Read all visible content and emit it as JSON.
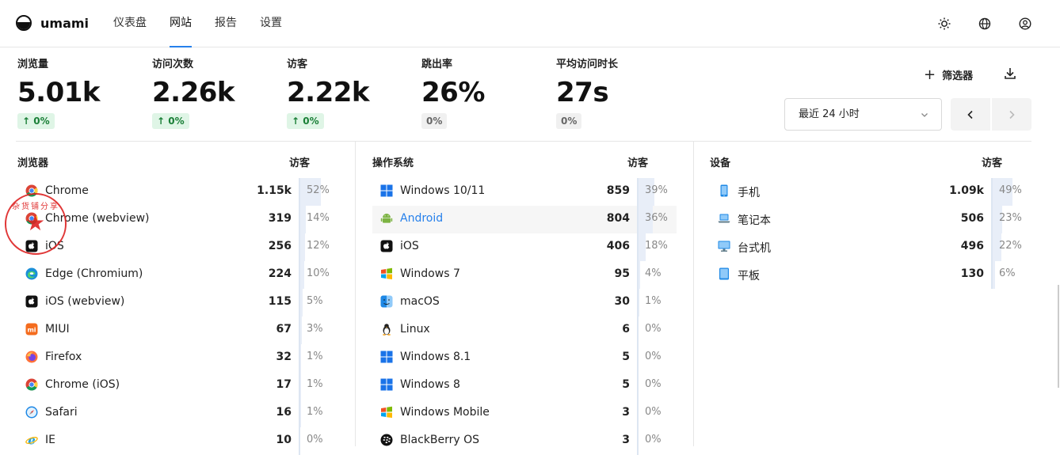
{
  "nav": {
    "brand": "umami",
    "items": [
      {
        "label": "仪表盘",
        "active": false
      },
      {
        "label": "网站",
        "active": true
      },
      {
        "label": "报告",
        "active": false
      },
      {
        "label": "设置",
        "active": false
      }
    ],
    "icons": [
      "sun-icon",
      "globe-icon",
      "user-icon"
    ]
  },
  "metrics": [
    {
      "label": "浏览量",
      "value": "5.01k",
      "change": "0%",
      "trend": "up"
    },
    {
      "label": "访问次数",
      "value": "2.26k",
      "change": "0%",
      "trend": "up"
    },
    {
      "label": "访客",
      "value": "2.22k",
      "change": "0%",
      "trend": "up"
    },
    {
      "label": "跳出率",
      "value": "26%",
      "change": "0%",
      "trend": "neutral"
    },
    {
      "label": "平均访问时长",
      "value": "27s",
      "change": "0%",
      "trend": "neutral"
    }
  ],
  "toolbar": {
    "filter_label": "筛选器",
    "date_range": "最近 24 小时"
  },
  "panels": [
    {
      "title": "浏览器",
      "metric_label": "访客",
      "rows": [
        {
          "label": "Chrome",
          "value": "1.15k",
          "pct": "52%",
          "share": 52,
          "icon": "chrome-icon"
        },
        {
          "label": "Chrome (webview)",
          "value": "319",
          "pct": "14%",
          "share": 14,
          "icon": "chrome-icon"
        },
        {
          "label": "iOS",
          "value": "256",
          "pct": "12%",
          "share": 12,
          "icon": "apple-icon"
        },
        {
          "label": "Edge (Chromium)",
          "value": "224",
          "pct": "10%",
          "share": 10,
          "icon": "edge-icon"
        },
        {
          "label": "iOS (webview)",
          "value": "115",
          "pct": "5%",
          "share": 5,
          "icon": "apple-icon"
        },
        {
          "label": "MIUI",
          "value": "67",
          "pct": "3%",
          "share": 3,
          "icon": "miui-icon"
        },
        {
          "label": "Firefox",
          "value": "32",
          "pct": "1%",
          "share": 1,
          "icon": "firefox-icon"
        },
        {
          "label": "Chrome (iOS)",
          "value": "17",
          "pct": "1%",
          "share": 1,
          "icon": "chrome-icon"
        },
        {
          "label": "Safari",
          "value": "16",
          "pct": "1%",
          "share": 1,
          "icon": "safari-icon"
        },
        {
          "label": "IE",
          "value": "10",
          "pct": "0%",
          "share": 0,
          "icon": "ie-icon"
        }
      ]
    },
    {
      "title": "操作系统",
      "metric_label": "访客",
      "rows": [
        {
          "label": "Windows 10/11",
          "value": "859",
          "pct": "39%",
          "share": 39,
          "icon": "windows-icon"
        },
        {
          "label": "Android",
          "value": "804",
          "pct": "36%",
          "share": 36,
          "icon": "android-icon",
          "highlight": true
        },
        {
          "label": "iOS",
          "value": "406",
          "pct": "18%",
          "share": 18,
          "icon": "apple-icon"
        },
        {
          "label": "Windows 7",
          "value": "95",
          "pct": "4%",
          "share": 4,
          "icon": "windows-legacy-icon"
        },
        {
          "label": "macOS",
          "value": "30",
          "pct": "1%",
          "share": 1,
          "icon": "macos-icon"
        },
        {
          "label": "Linux",
          "value": "6",
          "pct": "0%",
          "share": 0,
          "icon": "linux-icon"
        },
        {
          "label": "Windows 8.1",
          "value": "5",
          "pct": "0%",
          "share": 0,
          "icon": "windows-icon"
        },
        {
          "label": "Windows 8",
          "value": "5",
          "pct": "0%",
          "share": 0,
          "icon": "windows-icon"
        },
        {
          "label": "Windows Mobile",
          "value": "3",
          "pct": "0%",
          "share": 0,
          "icon": "windows-legacy-icon"
        },
        {
          "label": "BlackBerry OS",
          "value": "3",
          "pct": "0%",
          "share": 0,
          "icon": "blackberry-icon"
        }
      ]
    },
    {
      "title": "设备",
      "metric_label": "访客",
      "rows": [
        {
          "label": "手机",
          "value": "1.09k",
          "pct": "49%",
          "share": 49,
          "icon": "mobile-icon"
        },
        {
          "label": "笔记本",
          "value": "506",
          "pct": "23%",
          "share": 23,
          "icon": "laptop-icon"
        },
        {
          "label": "台式机",
          "value": "496",
          "pct": "22%",
          "share": 22,
          "icon": "desktop-icon"
        },
        {
          "label": "平板",
          "value": "130",
          "pct": "6%",
          "share": 6,
          "icon": "tablet-icon"
        }
      ]
    }
  ],
  "stamp": {
    "text": "杂货铺分享"
  },
  "colors": {
    "accent": "#2680eb",
    "positive": "#1a7f37",
    "bar": "#e8eef8"
  }
}
